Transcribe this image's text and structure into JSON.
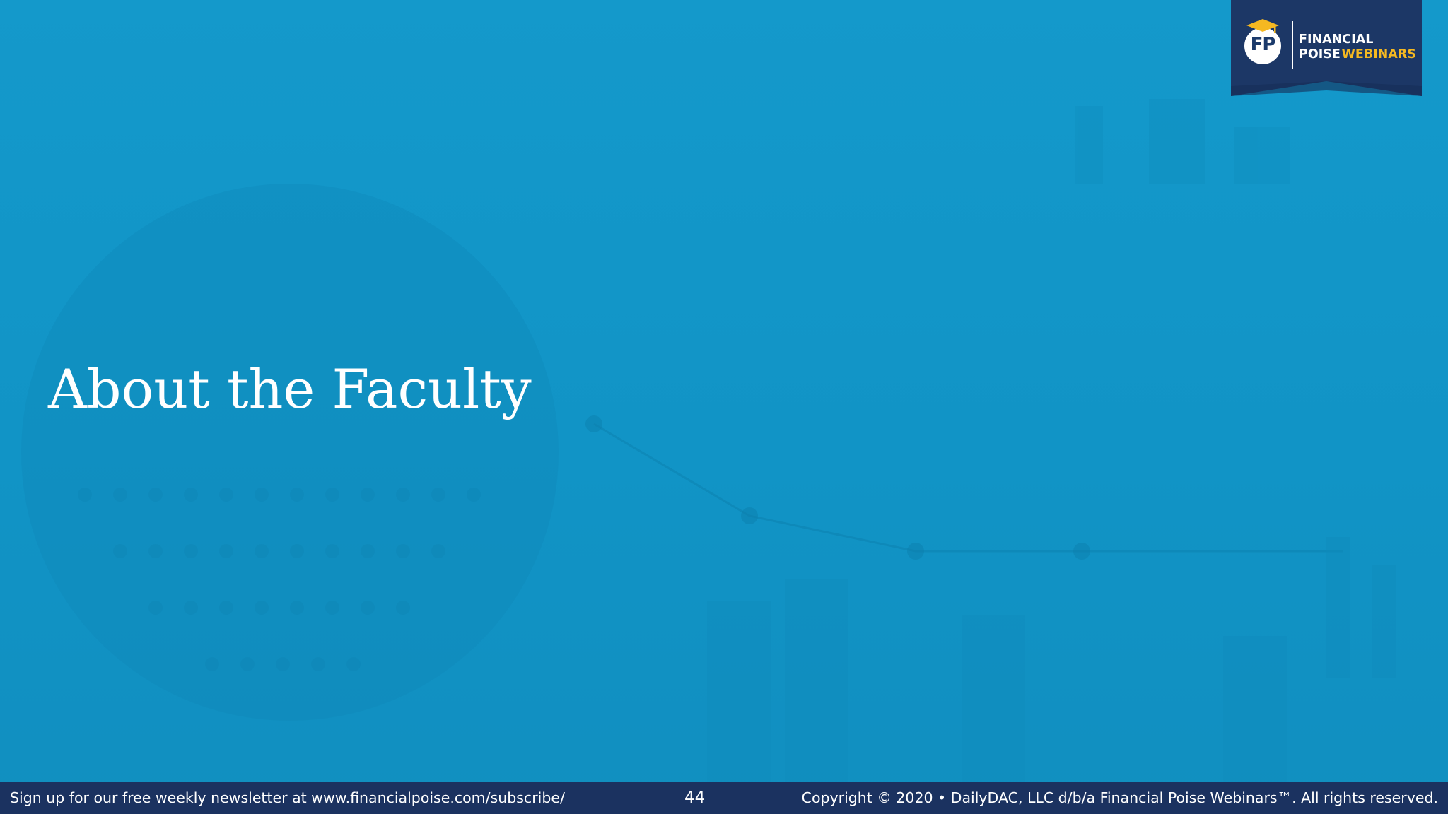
{
  "slide": {
    "title": "About the Faculty",
    "page_number": "44"
  },
  "logo": {
    "mark": "FP",
    "line1": "FINANCIAL",
    "line2_a": "POISE",
    "line2_b": "WEBINARS",
    "mark_icon": "graduation-cap-icon"
  },
  "footer": {
    "left_text": "Sign up for our free weekly newsletter at www.financialpoise.com/subscribe/",
    "right_text": "Copyright © 2020 • DailyDAC, LLC d/b/a Financial Poise Webinars™. All rights reserved."
  },
  "colors": {
    "background": "#1096c7",
    "footer_bg": "#1b3260",
    "banner_bg": "#1c3766",
    "accent_gold": "#f5b821",
    "text": "#ffffff"
  }
}
